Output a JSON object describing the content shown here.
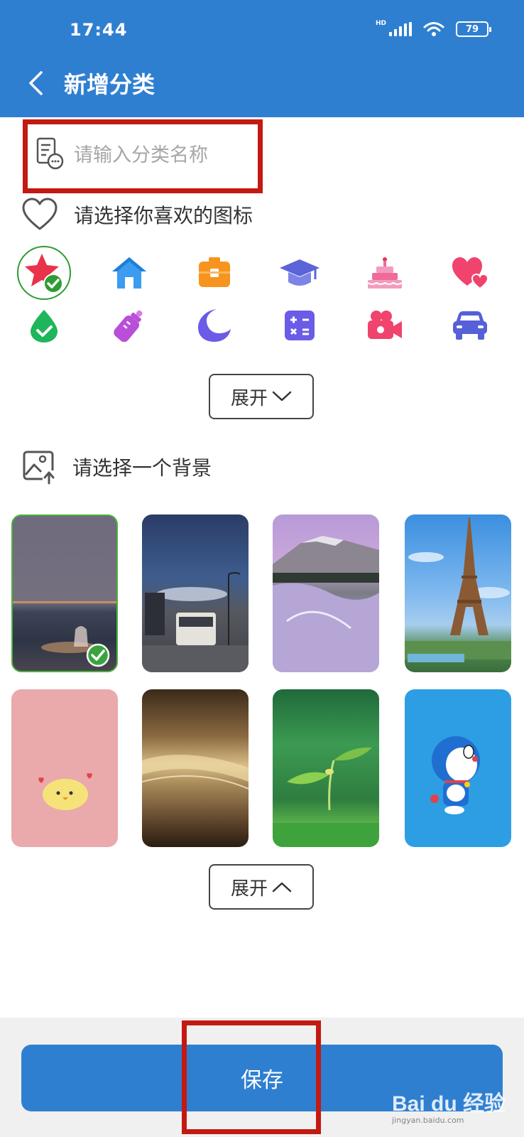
{
  "status_bar": {
    "time": "17:44",
    "network": "HD",
    "battery": "79"
  },
  "header": {
    "title": "新增分类"
  },
  "name_field": {
    "placeholder": "请输入分类名称",
    "value": ""
  },
  "icon_section": {
    "label": "请选择你喜欢的图标",
    "icons": [
      {
        "name": "star-icon",
        "color": "#e8334a",
        "selected": true
      },
      {
        "name": "home-icon",
        "color": "#2f8fe8"
      },
      {
        "name": "briefcase-icon",
        "color": "#f7941d"
      },
      {
        "name": "graduation-cap-icon",
        "color": "#5b64d9"
      },
      {
        "name": "cake-icon",
        "color": "#f06a9b"
      },
      {
        "name": "heart-icon",
        "color": "#f0436d"
      },
      {
        "name": "water-drop-check-icon",
        "color": "#1fb65b"
      },
      {
        "name": "baby-bottle-icon",
        "color": "#b94fd8"
      },
      {
        "name": "moon-icon",
        "color": "#6a5ce6"
      },
      {
        "name": "calculator-icon",
        "color": "#6a5ce6"
      },
      {
        "name": "video-camera-icon",
        "color": "#f0436d"
      },
      {
        "name": "car-icon",
        "color": "#5560d9"
      }
    ],
    "expand_label": "展开"
  },
  "background_section": {
    "label": "请选择一个背景",
    "backgrounds": [
      {
        "name": "bg-beach-dusk",
        "selected": true
      },
      {
        "name": "bg-street-bus"
      },
      {
        "name": "bg-snow-mountain"
      },
      {
        "name": "bg-eiffel-tower"
      },
      {
        "name": "bg-pink-chick"
      },
      {
        "name": "bg-golden-wave"
      },
      {
        "name": "bg-green-sprout"
      },
      {
        "name": "bg-doraemon"
      }
    ],
    "collapse_label": "展开"
  },
  "save": {
    "label": "保存"
  },
  "watermark": {
    "main": "Bai du 经验",
    "sub": "jingyan.baidu.com"
  },
  "colors": {
    "primary": "#2f7fd1",
    "highlight": "#c21a12",
    "selected": "#2e9c33"
  }
}
